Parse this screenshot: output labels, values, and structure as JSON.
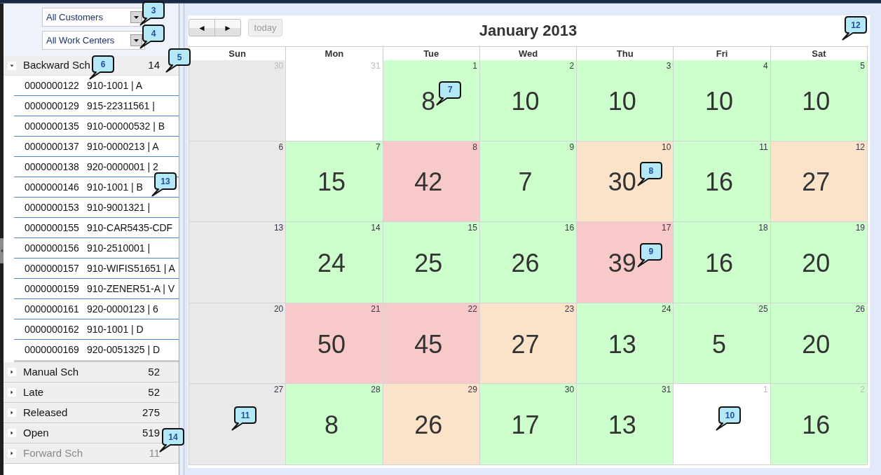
{
  "filters": [
    {
      "value": "All Customers",
      "callout": "3"
    },
    {
      "value": "All Work Centers",
      "callout": "4"
    }
  ],
  "sections": [
    {
      "label": "Backward Sch",
      "count": "14",
      "expanded": true,
      "disabled": false,
      "label_callout": "6",
      "count_callout": "5",
      "rows": [
        {
          "order": "0000000122",
          "part": "910-1001 | A"
        },
        {
          "order": "0000000129",
          "part": "915-22311561 |"
        },
        {
          "order": "0000000135",
          "part": "910-00000532 | B"
        },
        {
          "order": "0000000137",
          "part": "910-0000213 | A"
        },
        {
          "order": "0000000138",
          "part": "920-0000001 | 2"
        },
        {
          "order": "0000000146",
          "part": "910-1001 | B",
          "callout": "13"
        },
        {
          "order": "0000000153",
          "part": "910-9001321 |"
        },
        {
          "order": "0000000155",
          "part": "910-CAR5435-CDF"
        },
        {
          "order": "0000000156",
          "part": "910-2510001 |"
        },
        {
          "order": "0000000157",
          "part": "910-WIFIS51651 | A"
        },
        {
          "order": "0000000159",
          "part": "910-ZENER51-A | V"
        },
        {
          "order": "0000000161",
          "part": "920-0000123 | 6"
        },
        {
          "order": "0000000162",
          "part": "910-1001 | D"
        },
        {
          "order": "0000000169",
          "part": "920-0051325 | D"
        }
      ]
    },
    {
      "label": "Manual Sch",
      "count": "52",
      "expanded": false,
      "disabled": false
    },
    {
      "label": "Late",
      "count": "52",
      "expanded": false,
      "disabled": false
    },
    {
      "label": "Released",
      "count": "275",
      "expanded": false,
      "disabled": false
    },
    {
      "label": "Open",
      "count": "519",
      "expanded": false,
      "disabled": false
    },
    {
      "label": "Forward Sch",
      "count": "11",
      "expanded": false,
      "disabled": true,
      "count_callout": "14"
    }
  ],
  "calendar": {
    "nav_buttons": [
      {
        "label": "◄"
      },
      {
        "label": "►"
      }
    ],
    "today_button": {
      "label": "today",
      "disabled": true
    },
    "title": "January 2013",
    "callout": "12",
    "weekdays": [
      "Sun",
      "Mon",
      "Tue",
      "Wed",
      "Thu",
      "Fri",
      "Sat"
    ],
    "weeks": [
      {
        "days": [
          {
            "day": "30",
            "other_month": true,
            "color": "#e9e9e9"
          },
          {
            "day": "31",
            "other_month": true,
            "color": "#ffffff"
          },
          {
            "day": "1",
            "other_month": false,
            "color": "#ccffcc",
            "count": "8",
            "callout": "7"
          },
          {
            "day": "2",
            "other_month": false,
            "color": "#ccffcc",
            "count": "10"
          },
          {
            "day": "3",
            "other_month": false,
            "color": "#ccffcc",
            "count": "10"
          },
          {
            "day": "4",
            "other_month": false,
            "color": "#ccffcc",
            "count": "10"
          },
          {
            "day": "5",
            "other_month": false,
            "color": "#ccffcc",
            "count": "10"
          }
        ]
      },
      {
        "days": [
          {
            "day": "6",
            "other_month": false,
            "color": "#e9e9e9"
          },
          {
            "day": "7",
            "other_month": false,
            "color": "#ccffcc",
            "count": "15"
          },
          {
            "day": "8",
            "other_month": false,
            "color": "#f7c9c9",
            "count": "42"
          },
          {
            "day": "9",
            "other_month": false,
            "color": "#ccffcc",
            "count": "7"
          },
          {
            "day": "10",
            "other_month": false,
            "color": "#fae3c9",
            "count": "30",
            "callout": "8"
          },
          {
            "day": "11",
            "other_month": false,
            "color": "#ccffcc",
            "count": "16"
          },
          {
            "day": "12",
            "other_month": false,
            "color": "#fae3c9",
            "count": "27"
          }
        ]
      },
      {
        "days": [
          {
            "day": "13",
            "other_month": false,
            "color": "#e9e9e9"
          },
          {
            "day": "14",
            "other_month": false,
            "color": "#ccffcc",
            "count": "24"
          },
          {
            "day": "15",
            "other_month": false,
            "color": "#ccffcc",
            "count": "25"
          },
          {
            "day": "16",
            "other_month": false,
            "color": "#ccffcc",
            "count": "26"
          },
          {
            "day": "17",
            "other_month": false,
            "color": "#f7c9c9",
            "count": "39",
            "callout": "9"
          },
          {
            "day": "18",
            "other_month": false,
            "color": "#ccffcc",
            "count": "16"
          },
          {
            "day": "19",
            "other_month": false,
            "color": "#ccffcc",
            "count": "20"
          }
        ]
      },
      {
        "days": [
          {
            "day": "20",
            "other_month": false,
            "color": "#e9e9e9"
          },
          {
            "day": "21",
            "other_month": false,
            "color": "#f7c9c9",
            "count": "50"
          },
          {
            "day": "22",
            "other_month": false,
            "color": "#f7c9c9",
            "count": "45"
          },
          {
            "day": "23",
            "other_month": false,
            "color": "#fae3c9",
            "count": "27"
          },
          {
            "day": "24",
            "other_month": false,
            "color": "#ccffcc",
            "count": "13"
          },
          {
            "day": "25",
            "other_month": false,
            "color": "#ccffcc",
            "count": "5"
          },
          {
            "day": "26",
            "other_month": false,
            "color": "#ccffcc",
            "count": "20"
          }
        ]
      },
      {
        "days": [
          {
            "day": "27",
            "other_month": false,
            "color": "#e9e9e9",
            "callout": "11"
          },
          {
            "day": "28",
            "other_month": false,
            "color": "#ccffcc",
            "count": "8"
          },
          {
            "day": "29",
            "other_month": false,
            "color": "#fae3c9",
            "count": "26"
          },
          {
            "day": "30",
            "other_month": false,
            "color": "#ccffcc",
            "count": "17"
          },
          {
            "day": "31",
            "other_month": false,
            "color": "#ccffcc",
            "count": "13"
          },
          {
            "day": "1",
            "other_month": true,
            "color": "#ffffff",
            "callout": "10"
          },
          {
            "day": "2",
            "other_month": true,
            "color": "#ccffcc",
            "count": "16"
          }
        ]
      }
    ]
  }
}
